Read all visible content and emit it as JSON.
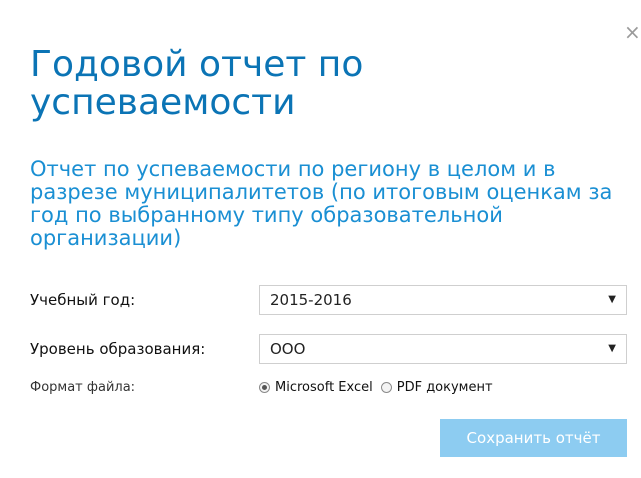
{
  "dialog": {
    "close_label": "×",
    "title": "Годовой отчет по успеваемости",
    "subtitle": "Отчет по успеваемости по региону в целом и в разрезе муниципалитетов (по итоговым оценкам за год по выбранному типу образовательной организации)"
  },
  "form": {
    "year": {
      "label": "Учебный год:",
      "value": "2015-2016"
    },
    "level": {
      "label": "Уровень образования:",
      "value": "ООО"
    },
    "format": {
      "label": "Формат файла:",
      "options": [
        {
          "label": "Microsoft Excel",
          "selected": true
        },
        {
          "label": "PDF документ",
          "selected": false
        }
      ]
    }
  },
  "actions": {
    "save_label": "Сохранить отчёт"
  },
  "colors": {
    "title": "#0b74b5",
    "subtitle": "#1a8fd3",
    "button": "#8dccf1"
  },
  "icons": {
    "close": "close-icon",
    "dropdown": "chevron-down-icon"
  }
}
